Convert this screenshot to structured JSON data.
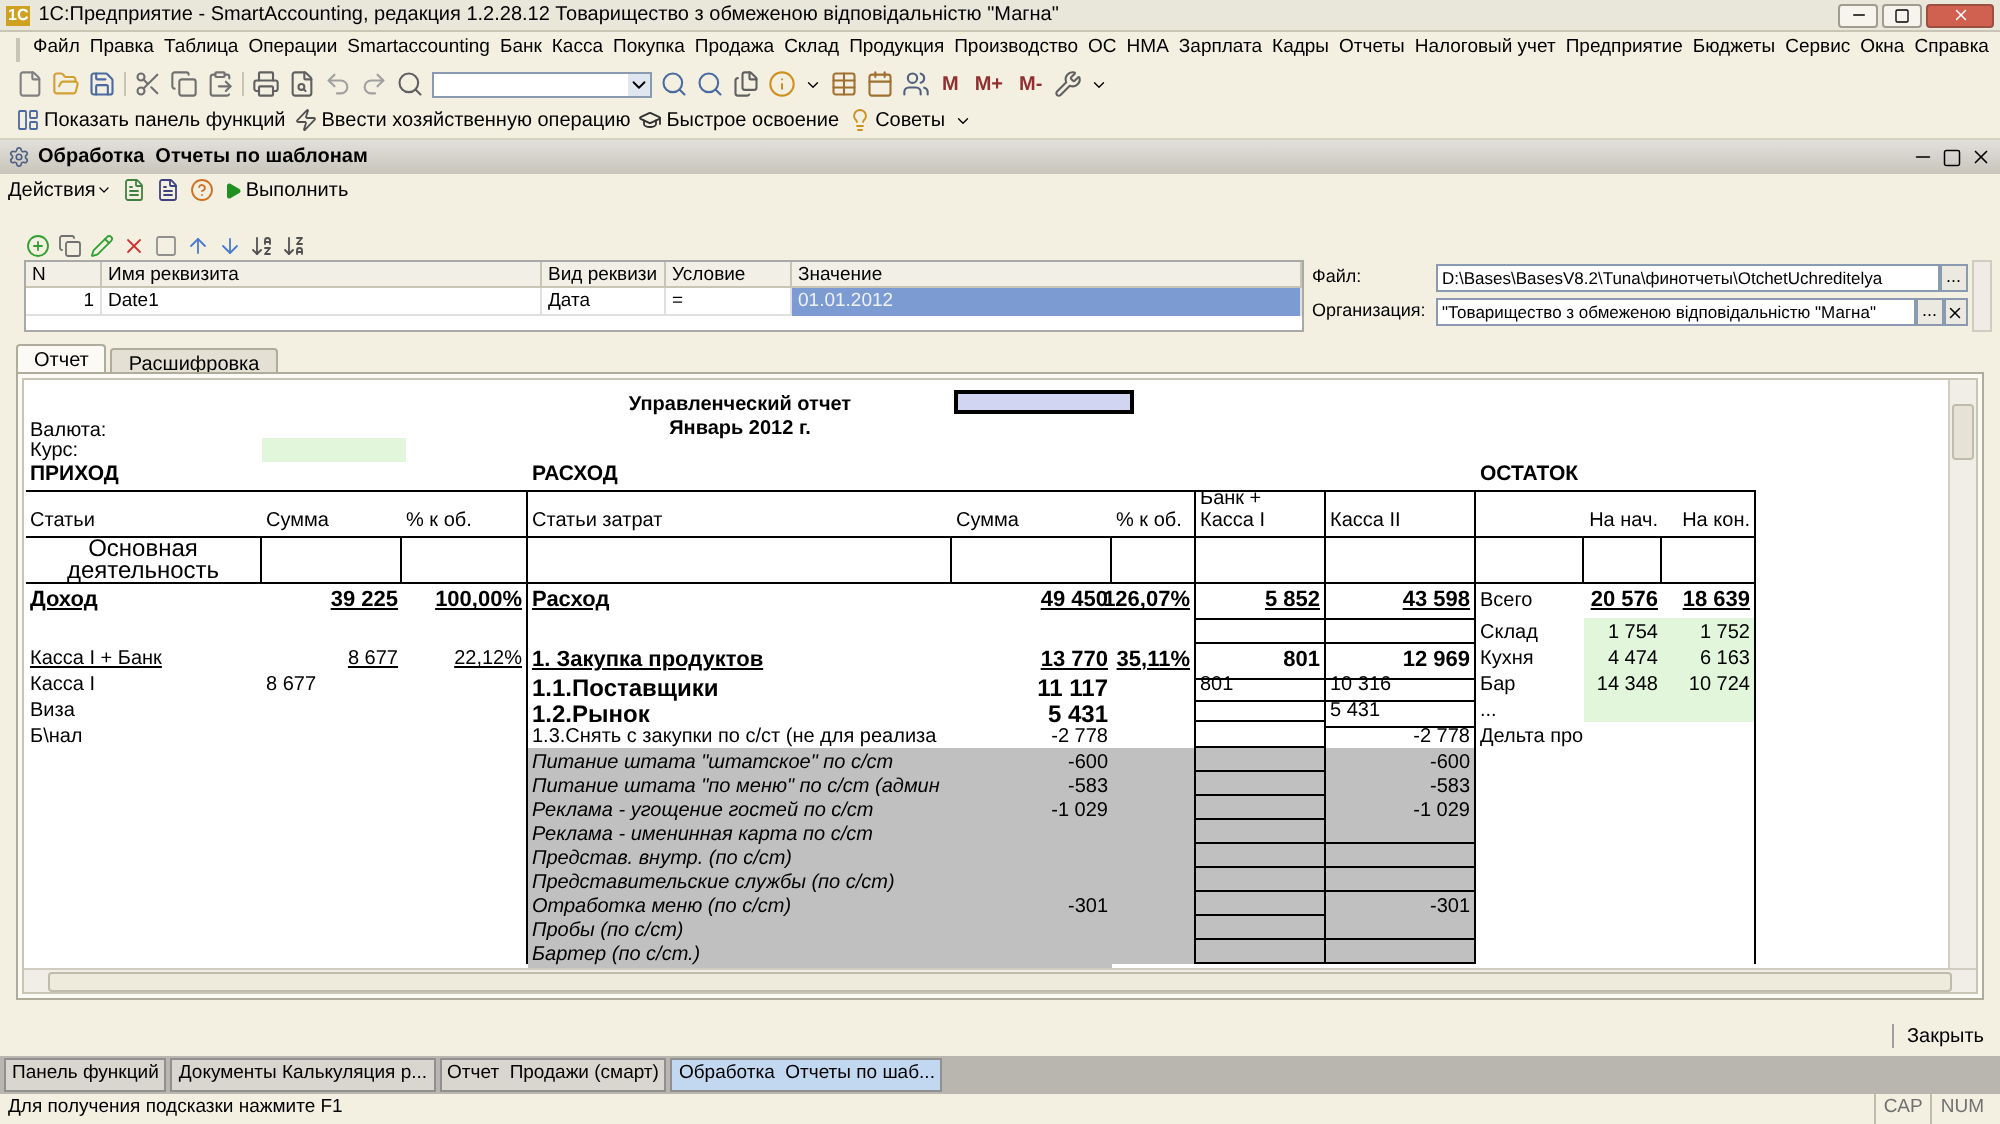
{
  "window": {
    "title": "1С:Предприятие - SmartAccounting, редакция 1.2.28.12 Товарищество з обмеженою відповідальністю \"Магна\"",
    "logo": "1С"
  },
  "menu": [
    "Файл",
    "Правка",
    "Таблица",
    "Операции",
    "Smartaccounting",
    "Банк",
    "Касса",
    "Покупка",
    "Продажа",
    "Склад",
    "Продукция",
    "Производство",
    "ОС",
    "НМА",
    "Зарплата",
    "Кадры",
    "Отчеты",
    "Налоговый учет",
    "Предприятие",
    "Бюджеты",
    "Сервис",
    "Окна",
    "Справка"
  ],
  "toolbar": {
    "memory_buttons": [
      "M",
      "M+",
      "M-"
    ]
  },
  "panel_toolbar": [
    "Показать панель функций",
    "Ввести хозяйственную операцию",
    "Быстрое освоение",
    "Советы"
  ],
  "subwindow": {
    "title": "Обработка  Отчеты по шаблонам",
    "actions": "Действия",
    "run": "Выполнить"
  },
  "params": {
    "columns": [
      "N",
      "Имя реквизита",
      "Вид реквизи",
      "Условие",
      "Значение"
    ],
    "rows": [
      {
        "cells": [
          "1",
          "Date1",
          "Дата",
          "=",
          "01.01.2012"
        ],
        "selected": true
      }
    ],
    "file_label": "Файл:",
    "file_value": "D:\\Bases\\BasesV8.2\\Tuna\\финотчеты\\OtchetUchreditelya",
    "file_button": "...",
    "org_label": "Организация:",
    "org_value": "\"Товарищество з обмеженою відповідальністю \"Магна\"",
    "org_button": "..."
  },
  "tabs": [
    {
      "label": "Отчет",
      "selected": true
    },
    {
      "label": "Расшифровка",
      "selected": false
    }
  ],
  "report": {
    "title": "Управленческий отчет",
    "period": "Январь 2012 г.",
    "currency_label": "Валюта:",
    "rate_label": "Курс:",
    "sections": [
      "ПРИХОД",
      "РАСХОД",
      "ОСТАТОК"
    ],
    "header": [
      "Статьи",
      "Сумма",
      "% к об.",
      "Статьи затрат",
      "Сумма",
      "% к об.",
      "Банк +\nКасса I",
      "Касса II",
      "На нач.",
      "На кон."
    ],
    "rows": [
      {
        "kind": "opening",
        "cells": [
          "Основная деятельность",
          null,
          null,
          null,
          null,
          null,
          null,
          null,
          null,
          null,
          null
        ]
      },
      {
        "kind": "total",
        "cells": [
          "Доход",
          "39 225",
          "100,00%",
          "Расход",
          "49 450",
          "126,07%",
          "5 852",
          "43 598",
          "Всего",
          "20 576",
          "18 639"
        ]
      },
      {
        "kind": "stock",
        "cells": [
          null,
          null,
          null,
          null,
          null,
          null,
          null,
          null,
          "Склад",
          "1 754",
          "1 752"
        ]
      },
      {
        "kind": "group",
        "cells": [
          "Касса I + Банк",
          "8 677",
          "22,12%",
          "1. Закупка продуктов",
          "13 770",
          "35,11%",
          "801",
          "12 969",
          "Кухня",
          "4 474",
          "6 163"
        ]
      },
      {
        "kind": "sub",
        "cells": [
          "Касса I",
          "8 677",
          null,
          "1.1.Поставщики",
          "11 117",
          null,
          "801",
          "10 316",
          "Бар",
          "14 348",
          "10 724"
        ]
      },
      {
        "kind": "sub2",
        "cells": [
          "Виза",
          null,
          null,
          "1.2.Рынок",
          "5 431",
          null,
          null,
          "5 431",
          "...",
          null,
          null
        ]
      },
      {
        "kind": "note",
        "cells": [
          "Б\\нал",
          null,
          null,
          "1.3.Снять с закупки по с/ст (не для реализа",
          "-2 778",
          null,
          null,
          "-2 778",
          "Дельта про",
          null,
          null
        ]
      },
      {
        "kind": "detail",
        "cells": [
          null,
          null,
          null,
          "Питание штата \"штатское\" по с/ст",
          "-600",
          null,
          null,
          "-600",
          null,
          null,
          null
        ]
      },
      {
        "kind": "detail",
        "cells": [
          null,
          null,
          null,
          "Питание штата \"по меню\" по с/ст (админ",
          "-583",
          null,
          null,
          "-583",
          null,
          null,
          null
        ]
      },
      {
        "kind": "detail",
        "cells": [
          null,
          null,
          null,
          "Реклама - угощение гостей по с/ст",
          "-1 029",
          null,
          null,
          "-1 029",
          null,
          null,
          null
        ]
      },
      {
        "kind": "detail",
        "cells": [
          null,
          null,
          null,
          "Реклама - именинная карта по с/ст",
          null,
          null,
          null,
          null,
          null,
          null,
          null
        ]
      },
      {
        "kind": "detail",
        "cells": [
          null,
          null,
          null,
          "Представ. внутр. (по с/ст)",
          null,
          null,
          null,
          null,
          null,
          null,
          null
        ]
      },
      {
        "kind": "detail",
        "cells": [
          null,
          null,
          null,
          "Представительские службы (по с/ст)",
          null,
          null,
          null,
          null,
          null,
          null,
          null
        ]
      },
      {
        "kind": "detail",
        "cells": [
          null,
          null,
          null,
          "Отработка меню (по с/ст)",
          "-301",
          null,
          null,
          "-301",
          null,
          null,
          null
        ]
      },
      {
        "kind": "detail",
        "cells": [
          null,
          null,
          null,
          "Пробы (по с/ст)",
          null,
          null,
          null,
          null,
          null,
          null,
          null
        ]
      },
      {
        "kind": "detail",
        "cells": [
          null,
          null,
          null,
          "Бартер (по с/ст.)",
          null,
          null,
          null,
          null,
          null,
          null,
          null
        ]
      }
    ]
  },
  "close_button": "Закрыть",
  "taskbar": [
    {
      "label": "Панель функций",
      "selected": false
    },
    {
      "label": "Документы Калькуляция р...",
      "selected": false
    },
    {
      "label": "Отчет  Продажи (смарт)",
      "selected": false
    },
    {
      "label": "Обработка  Отчеты по шаб...",
      "selected": true
    }
  ],
  "status_bar": {
    "hint": "Для получения подсказки нажмите F1",
    "indicators": [
      "CAP",
      "NUM"
    ]
  }
}
